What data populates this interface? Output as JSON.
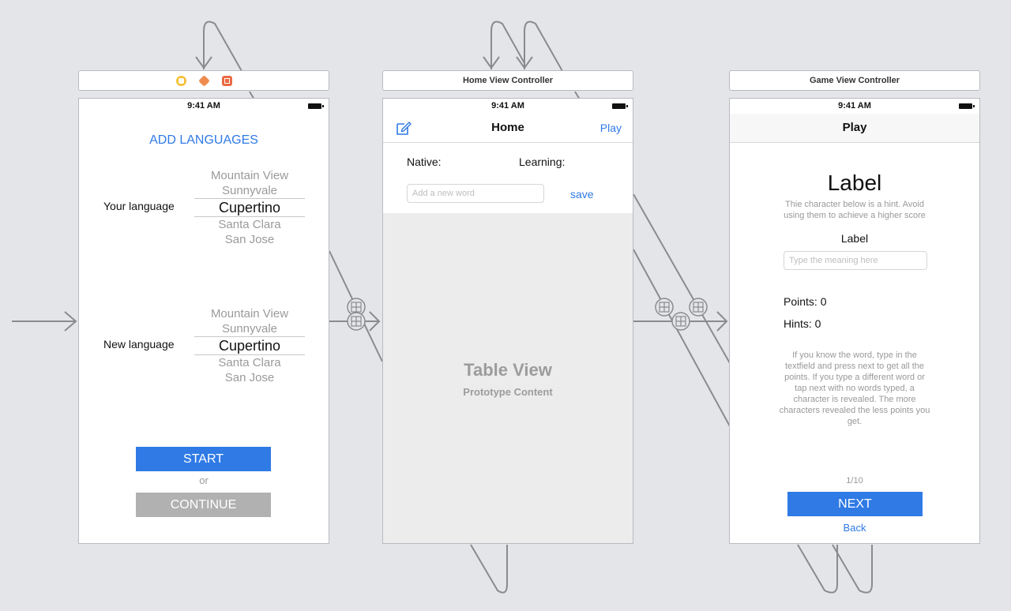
{
  "scenes": {
    "languages": {
      "status_time": "9:41 AM",
      "title": "ADD LANGUAGES",
      "your_language_label": "Your language",
      "new_language_label": "New language",
      "picker_items": [
        "Mountain View",
        "Sunnyvale",
        "Cupertino",
        "Santa Clara",
        "San Jose"
      ],
      "start_label": "START",
      "or_label": "or",
      "continue_label": "CONTINUE"
    },
    "home": {
      "bar_title": "Home View Controller",
      "status_time": "9:41 AM",
      "nav_title": "Home",
      "nav_right": "Play",
      "native_label": "Native:",
      "learning_label": "Learning:",
      "word_placeholder": "Add a new word",
      "save_label": "save",
      "table_title": "Table View",
      "table_subtitle": "Prototype Content"
    },
    "game": {
      "bar_title": "Game View Controller",
      "status_time": "9:41 AM",
      "nav_title": "Play",
      "big_label": "Label",
      "hint_text": "Thie character below is a hint. Avoid using them to achieve a higher score",
      "small_label": "Label",
      "meaning_placeholder": "Type the meaning here",
      "points": "Points: 0",
      "hints": "Hints: 0",
      "info_text": "If you know the word, type in the textfield and press next to get all the points. If you type a different word or tap next with no words typed, a character is revealed. The more characters revealed the less points you get.",
      "progress": "1/10",
      "next_label": "NEXT",
      "back_label": "Back"
    }
  },
  "colors": {
    "accent": "#2f7ae5",
    "continue_gray": "#b1b1b1",
    "canvas": "#e4e5e8"
  },
  "icons": [
    "segue-icon",
    "compose-icon",
    "entry-arrow-icon"
  ]
}
